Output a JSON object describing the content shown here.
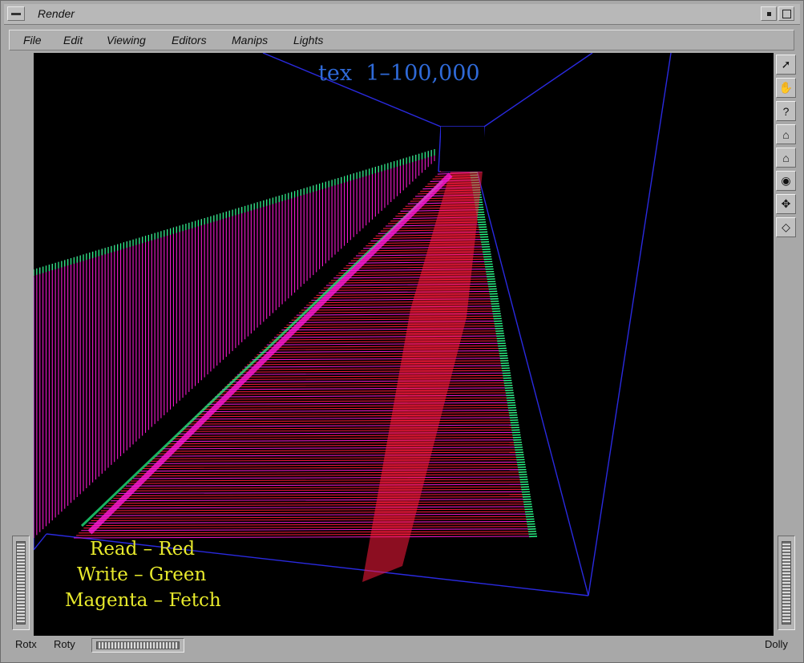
{
  "window": {
    "title": "Render"
  },
  "menubar": {
    "items": [
      "File",
      "Edit",
      "Viewing",
      "Editors",
      "Manips",
      "Lights"
    ]
  },
  "viewer": {
    "title_label": "tex  1–100,000",
    "legend": [
      "Read – Red",
      "Write – Green",
      "Magenta – Fetch"
    ],
    "colors": {
      "background": "#000000",
      "room_lines": "#2a2ae0",
      "title": "#2f6ad8",
      "legend": "#e8ea2c",
      "read": "#ff1a3c",
      "write": "#22ff88",
      "fetch": "#ff1ad9"
    }
  },
  "right_toolbar": {
    "tools": [
      {
        "name": "pick-arrow-icon",
        "glyph": "➚"
      },
      {
        "name": "hand-view-icon",
        "glyph": "✋"
      },
      {
        "name": "help-icon",
        "glyph": "?"
      },
      {
        "name": "home-icon",
        "glyph": "⌂"
      },
      {
        "name": "set-home-icon",
        "glyph": "⌂"
      },
      {
        "name": "view-all-icon",
        "glyph": "◉"
      },
      {
        "name": "seek-icon",
        "glyph": "✥"
      },
      {
        "name": "perspective-icon",
        "glyph": "◇"
      }
    ]
  },
  "bottom_bar": {
    "rotx_label": "Rotx",
    "roty_label": "Roty",
    "dolly_label": "Dolly"
  }
}
